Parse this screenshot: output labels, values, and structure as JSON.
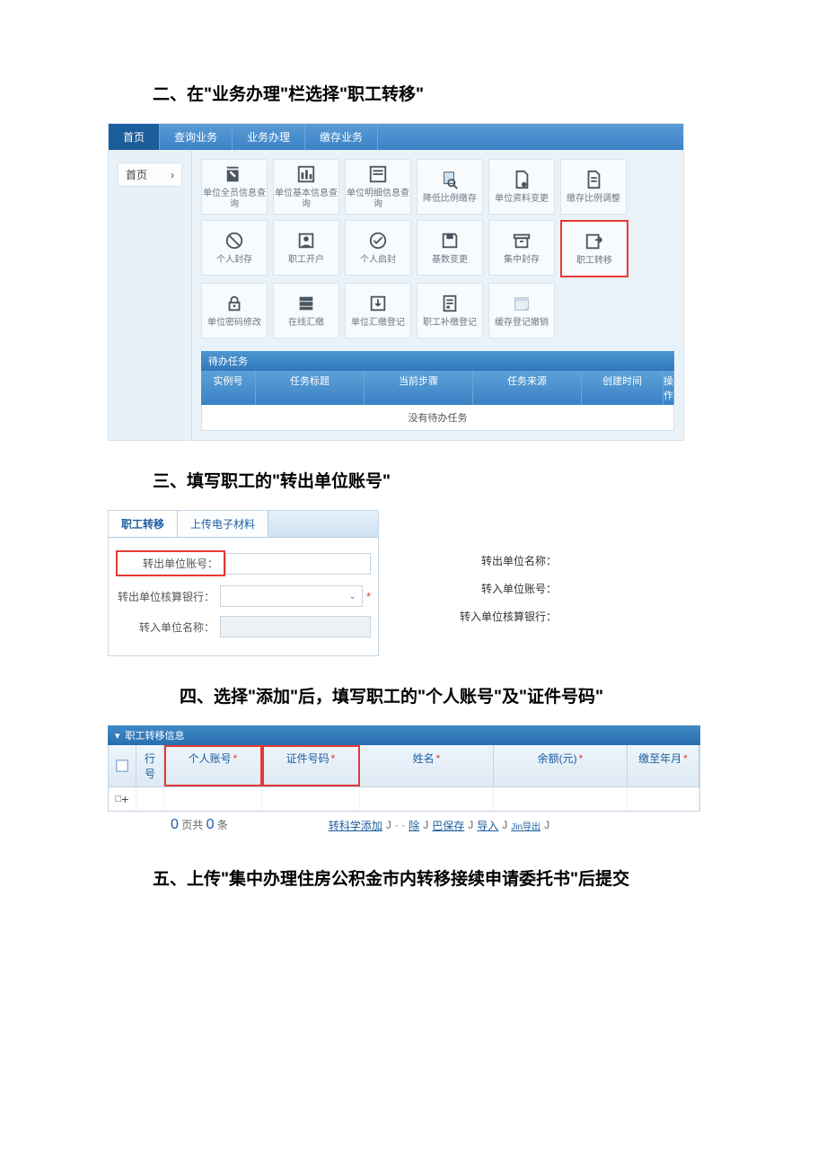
{
  "headings": {
    "h2": "二、在\"业务办理\"栏选择\"职工转移\"",
    "h3": "三、填写职工的\"转出单位账号\"",
    "h4": "四、选择\"添加\"后，填写职工的\"个人账号\"及\"证件号码\"",
    "h5": "五、上传\"集中办理住房公积金市内转移接续申请委托书\"后提交"
  },
  "sc1": {
    "nav": [
      "首页",
      "查询业务",
      "业务办理",
      "缴存业务"
    ],
    "side": "首页",
    "tiles": [
      "单位全员信息查询",
      "单位基本信息查询",
      "单位明细信息查询",
      "降低比例缴存",
      "单位资料变更",
      "缴存比例调整",
      "个人封存",
      "职工开户",
      "个人启封",
      "基数变更",
      "集中封存",
      "职工转移",
      "单位密码修改",
      "在线汇缴",
      "单位汇缴登记",
      "职工补缴登记",
      "缓存登记撤销"
    ],
    "highlight_index": 11,
    "task_title": "待办任务",
    "task_cols": [
      "实例号",
      "任务标题",
      "当前步骤",
      "任务来源",
      "创建时间",
      "操作"
    ],
    "task_empty": "没有待办任务"
  },
  "sc2": {
    "tabs": [
      "职工转移",
      "上传电子材料"
    ],
    "fields_left": [
      {
        "label": "转出单位账号：",
        "hl": true,
        "type": "text"
      },
      {
        "label": "转出单位核算银行：",
        "hl": false,
        "type": "dropdown"
      },
      {
        "label": "转入单位名称：",
        "hl": false,
        "type": "text"
      }
    ],
    "fields_right": [
      "转出单位名称：",
      "转入单位账号：",
      "转入单位核算银行："
    ]
  },
  "sc3": {
    "title": "职工转移信息",
    "cols": {
      "row": "行号",
      "acc": "个人账号",
      "id": "证件号码",
      "name": "姓名",
      "amt": "余额(元)",
      "date": "缴至年月"
    },
    "pager": {
      "page_text_a": "页共",
      "page_text_b": "条",
      "zero": "0",
      "links": [
        "转科学添加",
        "除",
        "巴保存",
        "导入",
        "Jin导出"
      ]
    }
  }
}
